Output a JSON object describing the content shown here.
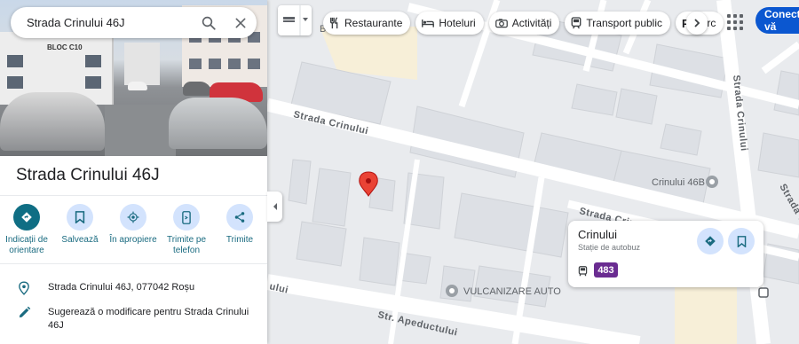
{
  "search": {
    "query": "Strada Crinului 46J"
  },
  "place": {
    "title": "Strada Crinului 46J",
    "photo_sign": "BLOC C10"
  },
  "actions": [
    {
      "label": "Indicații de orientare",
      "icon": "directions-icon"
    },
    {
      "label": "Salvează",
      "icon": "bookmark-icon"
    },
    {
      "label": "În apropiere",
      "icon": "nearby-icon"
    },
    {
      "label": "Trimite pe telefon",
      "icon": "send-to-phone-icon"
    },
    {
      "label": "Trimite",
      "icon": "share-icon"
    }
  ],
  "info": {
    "address": "Strada Crinului 46J, 077042 Roșu",
    "suggest_edit": "Sugerează o modificare pentru Strada Crinului 46J"
  },
  "chips": [
    {
      "label": "Restaurante",
      "icon": "fork-knife-icon"
    },
    {
      "label": "Hoteluri",
      "icon": "bed-icon"
    },
    {
      "label": "Activități",
      "icon": "camera-icon"
    },
    {
      "label": "Transport public",
      "icon": "train-icon"
    },
    {
      "label": "Parc",
      "icon": "parking-icon"
    }
  ],
  "signin_label": "Conectați-vă",
  "map": {
    "streets": {
      "crinului_1": "Strada Crinului",
      "crinului_2": "Strada Crinului",
      "crinului_3": "Strada Crinului",
      "apeductului": "Str. Apeductului",
      "cicoarei": "Strada Cicoarei",
      "corner": "Bo",
      "edge_ulu": "ului"
    },
    "pois": {
      "crinului_46b": "Crinului 46B",
      "vulcanizare": "VULCANIZARE AUTO"
    }
  },
  "stop_card": {
    "name": "Crinului",
    "type": "Stație de autobuz",
    "line": "483",
    "line_color": "#6a2c91"
  },
  "colors": {
    "accent": "#0b57d0",
    "pin": "#ea4335",
    "road": "#ffffff",
    "building": "#dadce0"
  }
}
